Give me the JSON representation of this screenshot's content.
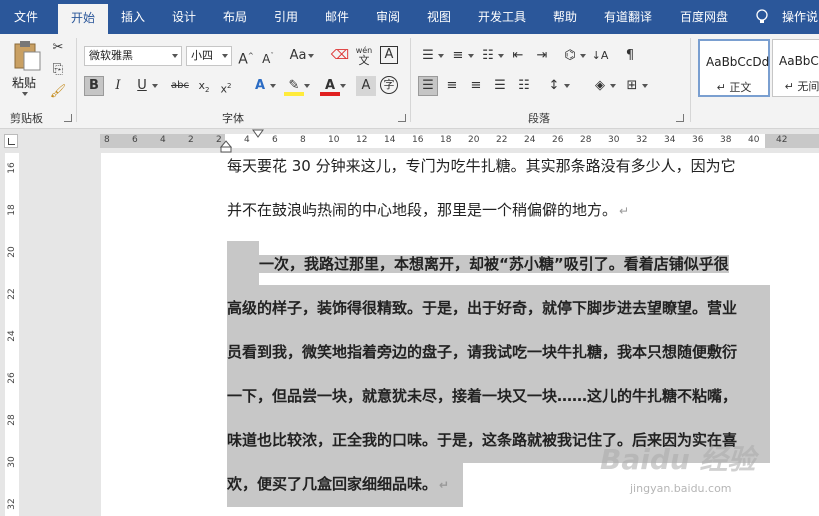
{
  "tabs": [
    "文件",
    "开始",
    "插入",
    "设计",
    "布局",
    "引用",
    "邮件",
    "审阅",
    "视图",
    "开发工具",
    "帮助",
    "有道翻译",
    "百度网盘"
  ],
  "active_tab": "开始",
  "tell_me": "操作说",
  "clipboard": {
    "paste_label": "粘贴",
    "group_label": "剪贴板"
  },
  "font": {
    "name": "微软雅黑",
    "size": "小四",
    "group_label": "字体",
    "wen_label": "wén",
    "wen_char": "文",
    "boxed_a": "A",
    "circled": "字"
  },
  "paragraph": {
    "group_label": "段落"
  },
  "styles": [
    {
      "sample": "AaBbCcDd",
      "name": "↵ 正文"
    },
    {
      "sample": "AaBbC",
      "name": "↵ 无间"
    }
  ],
  "ruler_numbers": [
    "8",
    "6",
    "4",
    "2",
    "2",
    "4",
    "6",
    "8",
    "10",
    "12",
    "14",
    "16",
    "18",
    "20",
    "22",
    "24",
    "26",
    "28",
    "30",
    "32",
    "34",
    "36",
    "38",
    "40",
    "42"
  ],
  "vruler_numbers": [
    "16",
    "18",
    "20",
    "22",
    "24",
    "26",
    "28",
    "30",
    "32"
  ],
  "document": {
    "lines": [
      "每天要花 30 分钟来这儿，专门为吃牛扎糖。其实那条路没有多少人，因为它",
      "并不在鼓浪屿热闹的中心地段，那里是一个稍偏僻的地方。",
      "一次，我路过那里，本想离开，却被“苏小糖”吸引了。看着店铺似乎很",
      "高级的样子，装饰得很精致。于是，出于好奇，就停下脚步进去望瞭望。营业",
      "员看到我，微笑地指着旁边的盘子，请我试吃一块牛扎糖，我本只想随便敷衍",
      "一下，但品尝一块，就意犹未尽，接着一块又一块……这儿的牛扎糖不粘嘴，",
      "味道也比较浓，正全我的口味。于是，这条路就被我记住了。后来因为实在喜",
      "欢，便买了几盒回家细细品味。"
    ],
    "para_mark": "↵"
  },
  "watermark": {
    "logo": "Baidu 经验",
    "url": "jingyan.baidu.com"
  }
}
